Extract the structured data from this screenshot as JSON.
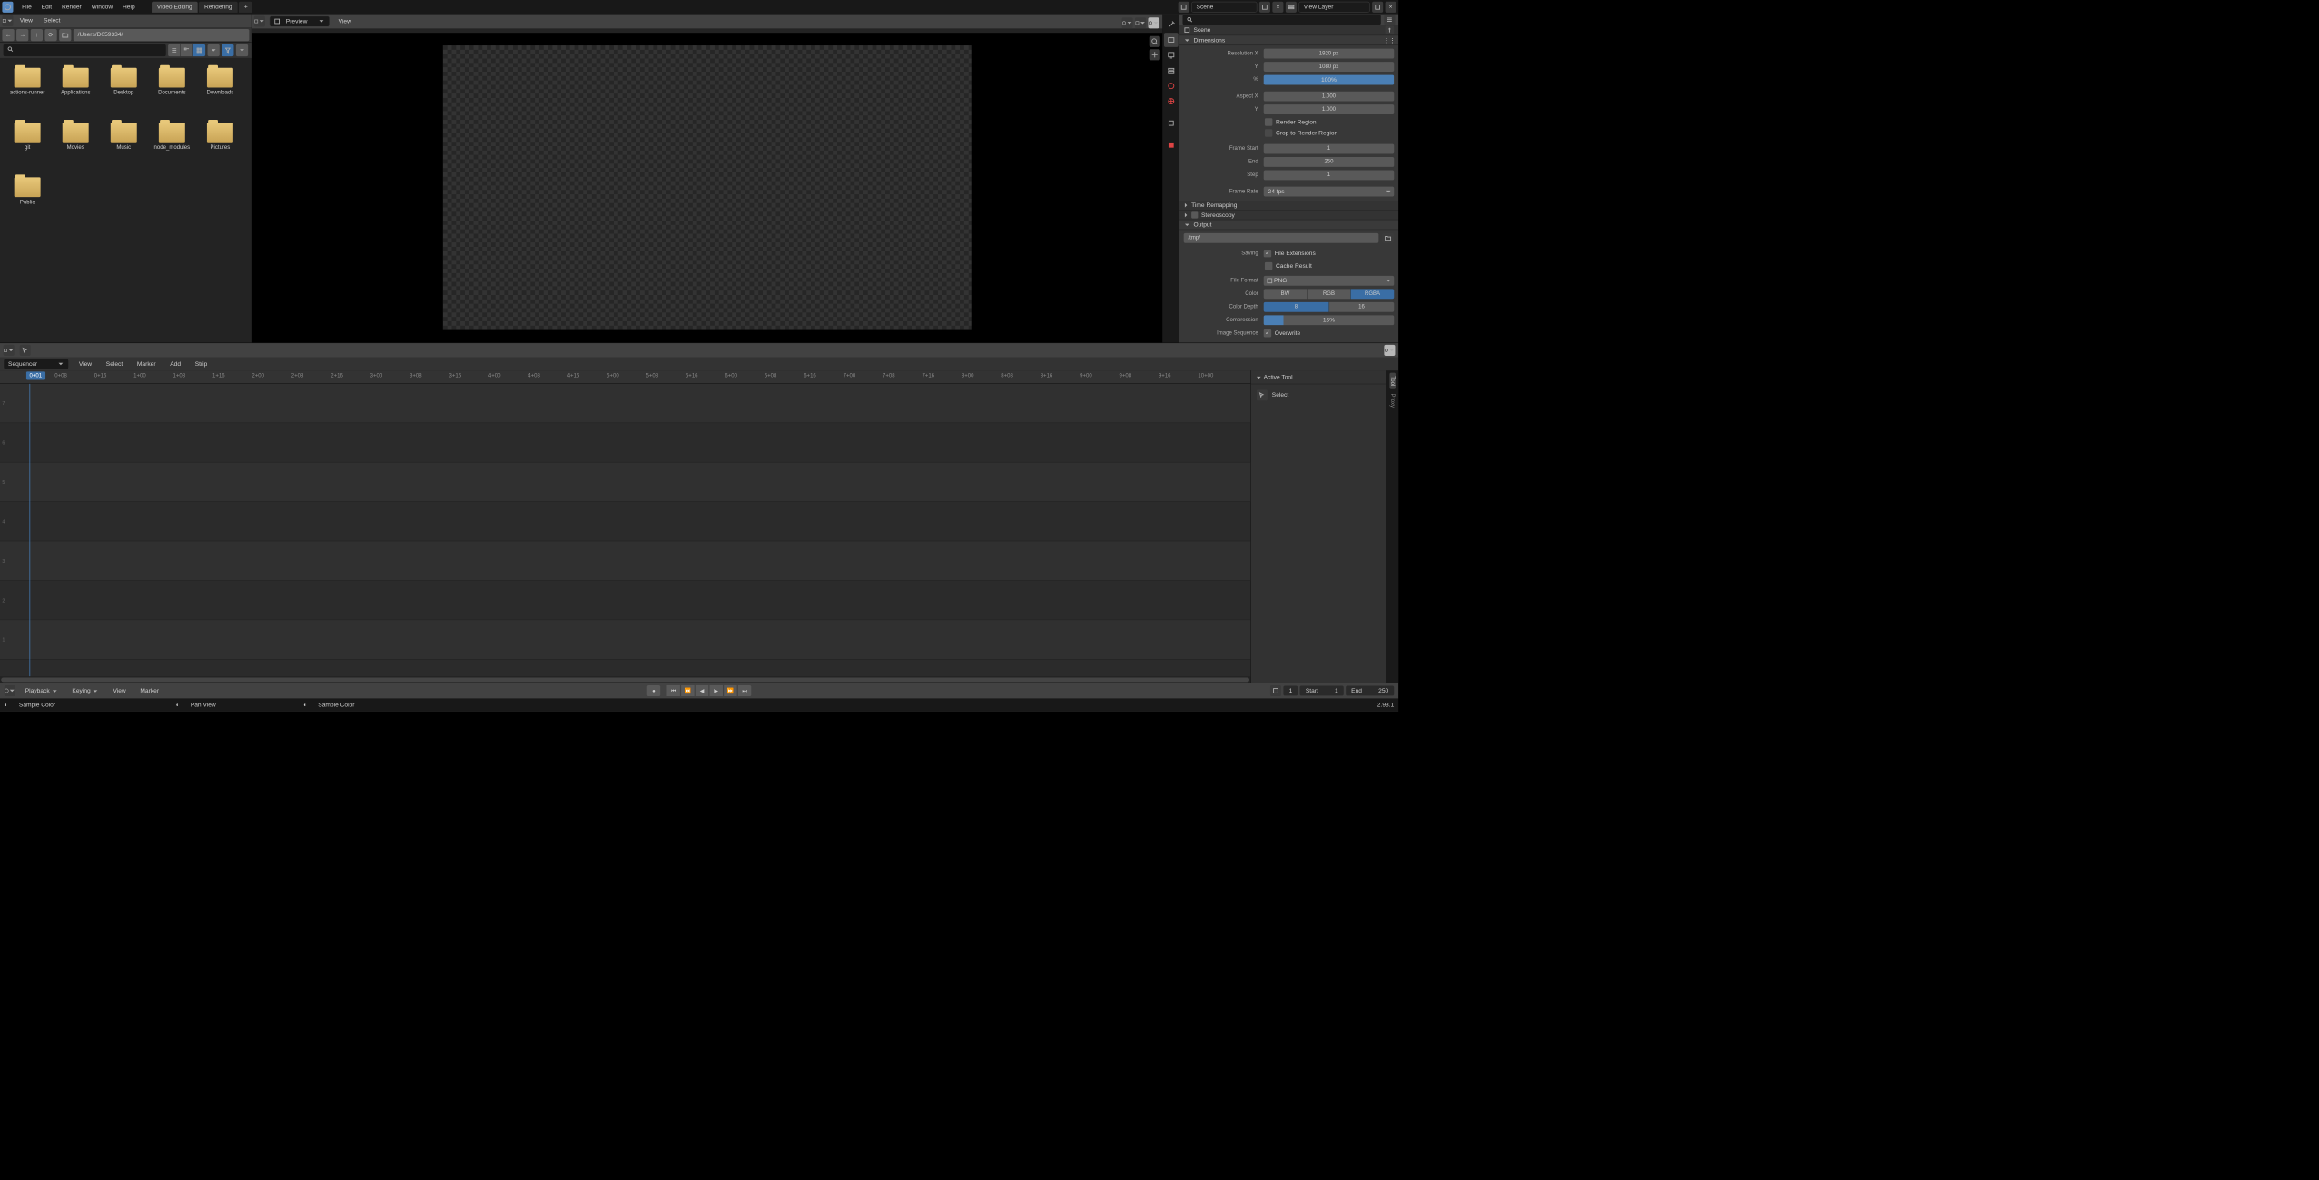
{
  "topbar": {
    "menus": [
      "File",
      "Edit",
      "Render",
      "Window",
      "Help"
    ],
    "workspaces": {
      "active": "Video Editing",
      "inactive": "Rendering"
    },
    "scene_label": "Scene",
    "viewlayer_label": "View Layer"
  },
  "file_browser": {
    "header": {
      "view": "View",
      "select": "Select"
    },
    "path": "/Users/D059334/",
    "folders": [
      "actions-runner",
      "Applications",
      "Desktop",
      "Documents",
      "Downloads",
      "git",
      "Movies",
      "Music",
      "node_modules",
      "Pictures",
      "Public"
    ]
  },
  "preview": {
    "mode": "Preview",
    "view": "View"
  },
  "properties": {
    "scene_label": "Scene",
    "dimensions": {
      "title": "Dimensions",
      "res_x_label": "Resolution X",
      "res_x": "1920 px",
      "res_y_label": "Y",
      "res_y": "1080 px",
      "pct_label": "%",
      "pct": "100%",
      "aspect_x_label": "Aspect X",
      "aspect_x": "1.000",
      "aspect_y_label": "Y",
      "aspect_y": "1.000",
      "render_region": "Render Region",
      "crop_region": "Crop to Render Region",
      "frame_start_label": "Frame Start",
      "frame_start": "1",
      "end_label": "End",
      "end": "250",
      "step_label": "Step",
      "step": "1",
      "frame_rate_label": "Frame Rate",
      "frame_rate": "24 fps"
    },
    "time_remapping": "Time Remapping",
    "stereoscopy": "Stereoscopy",
    "output": {
      "title": "Output",
      "path": "/tmp/",
      "saving_label": "Saving",
      "file_extensions": "File Extensions",
      "cache_result": "Cache Result",
      "file_format_label": "File Format",
      "file_format": "PNG",
      "color_label": "Color",
      "color_opts": [
        "BW",
        "RGB",
        "RGBA"
      ],
      "color_active": 2,
      "depth_label": "Color Depth",
      "depth_opts": [
        "8",
        "16"
      ],
      "depth_active": 0,
      "compression_label": "Compression",
      "compression": "15%",
      "image_sequence_label": "Image Sequence",
      "overwrite": "Overwrite"
    }
  },
  "sequencer": {
    "mode": "Sequencer",
    "menus": [
      "View",
      "Select",
      "Marker",
      "Add",
      "Strip"
    ],
    "current_frame": "0+01",
    "ruler": [
      "0+08",
      "0+16",
      "1+00",
      "1+08",
      "1+16",
      "2+00",
      "2+08",
      "2+16",
      "3+00",
      "3+08",
      "3+16",
      "4+00",
      "4+08",
      "4+16",
      "5+00",
      "5+08",
      "5+16",
      "6+00",
      "6+08",
      "6+16",
      "7+00",
      "7+08",
      "7+16",
      "8+00",
      "8+08",
      "8+16",
      "9+00",
      "9+08",
      "9+16",
      "10+00"
    ],
    "tracks": [
      "7",
      "6",
      "5",
      "4",
      "3",
      "2",
      "1"
    ],
    "side": {
      "title": "Active Tool",
      "tool": "Select",
      "tabs": [
        "Tool",
        "Proxy"
      ]
    }
  },
  "playback": {
    "menus": [
      "Playback",
      "Keying",
      "View",
      "Marker"
    ],
    "frame_field_label": "",
    "frame": "1",
    "start_label": "Start",
    "start": "1",
    "end_label": "End",
    "end": "250"
  },
  "status": {
    "left1": "Sample Color",
    "mid1": "Pan View",
    "mid2": "Sample Color",
    "version": "2.93.1"
  }
}
